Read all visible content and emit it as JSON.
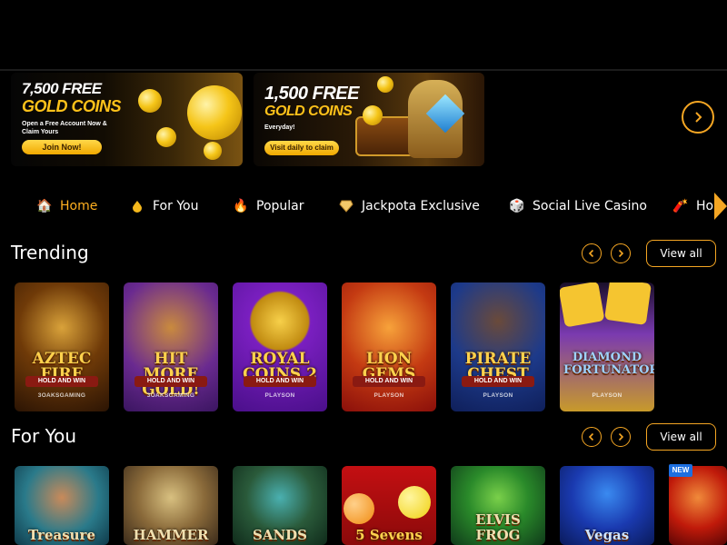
{
  "banners": [
    {
      "amount": "7,500 FREE",
      "headline": "GOLD COINS",
      "sub": "Open a Free Account Now & Claim Yours",
      "cta": "Join Now!"
    },
    {
      "amount": "1,500 FREE",
      "headline": "GOLD COINS",
      "sub": "Everyday!",
      "cta": "Visit daily to claim"
    }
  ],
  "categories": [
    {
      "label": "Home",
      "icon": "home-icon",
      "active": true
    },
    {
      "label": "For You",
      "icon": "coin-drop-icon",
      "active": false
    },
    {
      "label": "Popular",
      "icon": "fire-icon",
      "active": false
    },
    {
      "label": "Jackpota Exclusive",
      "icon": "diamond-icon",
      "active": false
    },
    {
      "label": "Social Live Casino",
      "icon": "dice-icon",
      "active": false
    },
    {
      "label": "Hol",
      "icon": "firecracker-icon",
      "active": false
    }
  ],
  "trending": {
    "title": "Trending",
    "view_all": "View all",
    "games": [
      {
        "name": "AZTEC FIRE",
        "tag": "HOLD AND WIN",
        "provider": "3OAKSGAMING"
      },
      {
        "name": "HIT MORE GOLD!",
        "tag": "HOLD AND WIN",
        "provider": "3OAKSGAMING"
      },
      {
        "name": "ROYAL COINS 2",
        "tag": "HOLD AND WIN",
        "provider": "PLAYSON"
      },
      {
        "name": "LION GEMS",
        "tag": "HOLD AND WIN",
        "provider": "PLAYSON"
      },
      {
        "name": "PIRATE CHEST",
        "tag": "HOLD AND WIN",
        "provider": "PLAYSON"
      },
      {
        "name": "DIAMOND FORTUNATOR",
        "tag": "",
        "provider": "PLAYSON"
      }
    ]
  },
  "for_you": {
    "title": "For You",
    "view_all": "View all",
    "new_badge": "NEW",
    "games": [
      {
        "name": "Treasure"
      },
      {
        "name": "HAMMER"
      },
      {
        "name": "SANDS"
      },
      {
        "name": "5 Sevens"
      },
      {
        "name": "ELVIS FROG"
      },
      {
        "name": "Vegas"
      },
      {
        "name": ""
      }
    ]
  },
  "colors": {
    "accent": "#f5a623",
    "active_tab": "#ffb020",
    "background": "#000000"
  }
}
